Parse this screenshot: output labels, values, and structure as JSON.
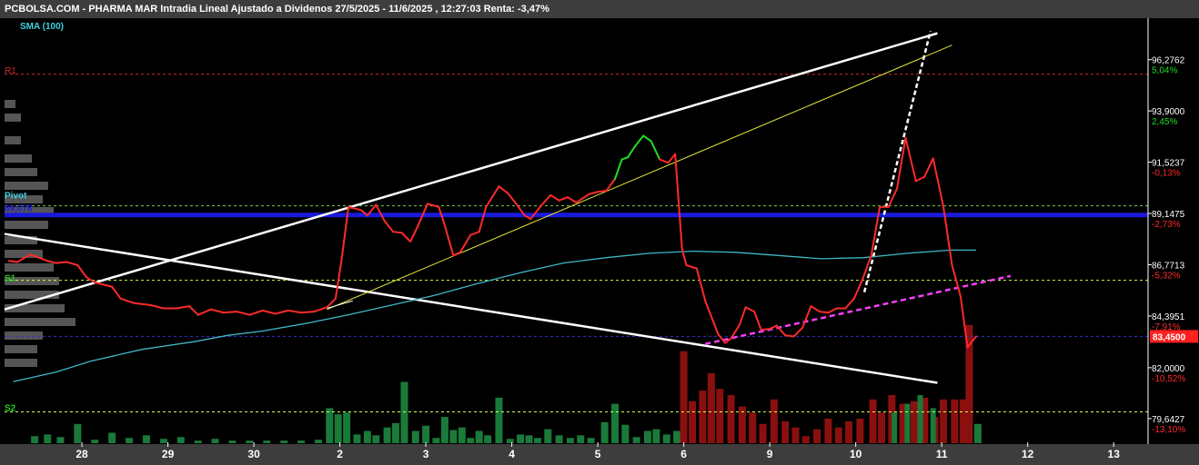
{
  "header": {
    "title": "PCBOLSA.COM - PHARMA MAR Intradia Lineal Ajustado a Dividenos 27/5/2025 - 11/6/2025 , 12:27:03 Renta: -3,47%"
  },
  "indicator_label": "SMA (100)",
  "colors": {
    "price_down": "#ff2a2a",
    "price_up": "#22dd22",
    "sma": "#3fb6c8",
    "pivot_band": "#1a1adc",
    "r1": "#d42a2a",
    "support": "#22cc22",
    "s1_line": "#c8ff50",
    "trend_white": "#ffffff",
    "trend_yellow": "#e8e838",
    "trend_magenta": "#ff40ff",
    "vol_up": "#1a7a3a",
    "vol_down": "#8a1010",
    "last_price_bg": "#ff2020"
  },
  "levels": {
    "r1": {
      "label": "R1",
      "value": 95.6
    },
    "pivot": {
      "label": "Pivot",
      "value_label": "89,078",
      "value": 89.078
    },
    "s1": {
      "label": "S1",
      "value": 86.05
    },
    "s2": {
      "label": "S2",
      "value": 79.95
    },
    "upper_dashed": 89.5,
    "current_dashed": 83.45
  },
  "last_price": "83,4500",
  "chart_data": {
    "type": "line",
    "x_tick_labels": [
      "28",
      "29",
      "30",
      "2",
      "3",
      "4",
      "5",
      "6",
      "9",
      "10",
      "11",
      "12",
      "13"
    ],
    "y_ticks": [
      {
        "value": 96.2762,
        "label": "96,2762",
        "pct": "5,04%",
        "pct_color": "#22dd22"
      },
      {
        "value": 93.9,
        "label": "93,9000",
        "pct": "2,45%",
        "pct_color": "#22dd22"
      },
      {
        "value": 91.5237,
        "label": "91,5237",
        "pct": "-0,13%",
        "pct_color": "#ff2a2a"
      },
      {
        "value": 89.1475,
        "label": "89,1475",
        "pct": "-2,73%",
        "pct_color": "#ff2a2a"
      },
      {
        "value": 86.7713,
        "label": "86,7713",
        "pct": "-5,32%",
        "pct_color": "#ff2a2a"
      },
      {
        "value": 84.3951,
        "label": "84,3951",
        "pct": "-7,91%",
        "pct_color": "#ff2a2a"
      },
      {
        "value": 82.0,
        "label": "82,0000",
        "pct": "-10,52%",
        "pct_color": "#ff2a2a"
      },
      {
        "value": 79.6427,
        "label": "79,6427",
        "pct": "-13,10%",
        "pct_color": "#ff2a2a"
      }
    ],
    "ylim": [
      78.5,
      98.2
    ],
    "x_range": [
      0,
      13.3
    ],
    "price": [
      [
        0.05,
        86.95
      ],
      [
        0.15,
        86.9
      ],
      [
        0.3,
        87.25
      ],
      [
        0.5,
        86.95
      ],
      [
        0.6,
        86.85
      ],
      [
        0.72,
        86.9
      ],
      [
        0.85,
        86.75
      ],
      [
        0.95,
        86.2
      ],
      [
        1.05,
        85.95
      ],
      [
        1.25,
        85.75
      ],
      [
        1.35,
        85.2
      ],
      [
        1.5,
        85.0
      ],
      [
        1.7,
        84.9
      ],
      [
        1.85,
        84.75
      ],
      [
        2.0,
        84.75
      ],
      [
        2.15,
        84.85
      ],
      [
        2.25,
        84.45
      ],
      [
        2.4,
        84.7
      ],
      [
        2.55,
        84.55
      ],
      [
        2.7,
        84.6
      ],
      [
        2.85,
        84.45
      ],
      [
        3.0,
        84.65
      ],
      [
        3.15,
        84.5
      ],
      [
        3.3,
        84.65
      ],
      [
        3.45,
        84.55
      ],
      [
        3.6,
        84.6
      ],
      [
        3.75,
        84.8
      ],
      [
        3.85,
        85.2
      ],
      [
        3.92,
        87.0
      ],
      [
        4.0,
        89.45
      ],
      [
        4.15,
        89.3
      ],
      [
        4.22,
        89.05
      ],
      [
        4.32,
        89.55
      ],
      [
        4.42,
        88.8
      ],
      [
        4.52,
        88.3
      ],
      [
        4.62,
        88.25
      ],
      [
        4.72,
        87.85
      ],
      [
        4.8,
        88.5
      ],
      [
        4.92,
        89.6
      ],
      [
        5.05,
        89.45
      ],
      [
        5.12,
        88.6
      ],
      [
        5.22,
        87.2
      ],
      [
        5.3,
        87.35
      ],
      [
        5.42,
        88.15
      ],
      [
        5.52,
        88.3
      ],
      [
        5.6,
        89.45
      ],
      [
        5.75,
        90.4
      ],
      [
        5.85,
        90.1
      ],
      [
        5.95,
        89.6
      ],
      [
        6.05,
        89.05
      ],
      [
        6.12,
        88.9
      ],
      [
        6.25,
        89.55
      ],
      [
        6.35,
        90.0
      ],
      [
        6.45,
        89.75
      ],
      [
        6.55,
        89.9
      ],
      [
        6.65,
        89.65
      ],
      [
        6.8,
        90.05
      ],
      [
        6.9,
        90.15
      ],
      [
        7.0,
        90.2
      ],
      [
        7.1,
        90.75
      ],
      [
        7.18,
        91.65
      ],
      [
        7.25,
        91.75
      ],
      [
        7.33,
        92.25
      ],
      [
        7.43,
        92.75
      ],
      [
        7.52,
        92.5
      ],
      [
        7.62,
        91.65
      ],
      [
        7.72,
        91.5
      ],
      [
        7.8,
        91.9
      ],
      [
        7.88,
        87.5
      ],
      [
        7.93,
        86.75
      ],
      [
        8.05,
        86.6
      ],
      [
        8.15,
        85.1
      ],
      [
        8.3,
        83.55
      ],
      [
        8.38,
        83.15
      ],
      [
        8.45,
        83.35
      ],
      [
        8.55,
        84.0
      ],
      [
        8.62,
        84.8
      ],
      [
        8.72,
        84.6
      ],
      [
        8.8,
        83.75
      ],
      [
        8.9,
        83.8
      ],
      [
        8.98,
        83.95
      ],
      [
        9.08,
        83.5
      ],
      [
        9.18,
        83.45
      ],
      [
        9.28,
        83.85
      ],
      [
        9.38,
        84.85
      ],
      [
        9.48,
        84.6
      ],
      [
        9.58,
        84.55
      ],
      [
        9.68,
        84.75
      ],
      [
        9.78,
        84.75
      ],
      [
        9.88,
        85.2
      ],
      [
        9.98,
        86.1
      ],
      [
        10.08,
        87.2
      ],
      [
        10.18,
        89.45
      ],
      [
        10.28,
        89.45
      ],
      [
        10.38,
        90.3
      ],
      [
        10.48,
        92.65
      ],
      [
        10.6,
        90.65
      ],
      [
        10.7,
        90.85
      ],
      [
        10.8,
        91.7
      ],
      [
        10.92,
        89.45
      ],
      [
        11.02,
        86.75
      ],
      [
        11.12,
        85.3
      ],
      [
        11.2,
        82.95
      ],
      [
        11.3,
        83.45
      ]
    ],
    "sma_100": [
      [
        0.1,
        81.35
      ],
      [
        0.6,
        81.8
      ],
      [
        1.0,
        82.3
      ],
      [
        1.6,
        82.85
      ],
      [
        2.2,
        83.2
      ],
      [
        2.6,
        83.5
      ],
      [
        3.0,
        83.7
      ],
      [
        3.5,
        84.05
      ],
      [
        4.0,
        84.45
      ],
      [
        4.5,
        84.9
      ],
      [
        5.0,
        85.35
      ],
      [
        5.5,
        85.9
      ],
      [
        6.0,
        86.4
      ],
      [
        6.5,
        86.85
      ],
      [
        7.0,
        87.1
      ],
      [
        7.5,
        87.3
      ],
      [
        8.0,
        87.4
      ],
      [
        8.5,
        87.35
      ],
      [
        9.0,
        87.2
      ],
      [
        9.5,
        87.05
      ],
      [
        10.0,
        87.1
      ],
      [
        10.5,
        87.3
      ],
      [
        11.0,
        87.45
      ],
      [
        11.3,
        87.45
      ]
    ],
    "volume": [
      [
        0.35,
        8
      ],
      [
        0.5,
        10
      ],
      [
        0.65,
        7
      ],
      [
        0.85,
        22
      ],
      [
        1.05,
        4
      ],
      [
        1.25,
        12
      ],
      [
        1.45,
        6
      ],
      [
        1.65,
        9
      ],
      [
        1.85,
        5
      ],
      [
        2.05,
        7
      ],
      [
        2.25,
        3
      ],
      [
        2.45,
        5
      ],
      [
        2.65,
        3
      ],
      [
        2.85,
        3
      ],
      [
        3.05,
        3
      ],
      [
        3.25,
        3
      ],
      [
        3.45,
        3
      ],
      [
        3.65,
        4
      ],
      [
        3.78,
        40
      ],
      [
        3.88,
        33
      ],
      [
        3.98,
        35
      ],
      [
        4.1,
        10
      ],
      [
        4.22,
        14
      ],
      [
        4.32,
        9
      ],
      [
        4.45,
        18
      ],
      [
        4.55,
        23
      ],
      [
        4.65,
        70
      ],
      [
        4.78,
        14
      ],
      [
        4.9,
        20
      ],
      [
        5.02,
        6
      ],
      [
        5.12,
        30
      ],
      [
        5.22,
        15
      ],
      [
        5.32,
        18
      ],
      [
        5.42,
        6
      ],
      [
        5.52,
        14
      ],
      [
        5.62,
        9
      ],
      [
        5.75,
        52
      ],
      [
        5.88,
        5
      ],
      [
        6.0,
        10
      ],
      [
        6.1,
        9
      ],
      [
        6.2,
        6
      ],
      [
        6.32,
        16
      ],
      [
        6.45,
        9
      ],
      [
        6.58,
        6
      ],
      [
        6.7,
        9
      ],
      [
        6.82,
        6
      ],
      [
        6.98,
        24
      ],
      [
        7.1,
        45
      ],
      [
        7.22,
        21
      ],
      [
        7.35,
        7
      ],
      [
        7.48,
        14
      ],
      [
        7.58,
        16
      ],
      [
        7.7,
        10
      ],
      [
        7.82,
        14
      ]
    ],
    "volume_down_marks": [
      [
        7.9,
        105
      ],
      [
        8.0,
        48
      ],
      [
        8.12,
        60
      ],
      [
        8.22,
        80
      ],
      [
        8.32,
        62
      ],
      [
        8.45,
        55
      ],
      [
        8.58,
        42
      ],
      [
        8.7,
        35
      ],
      [
        8.82,
        22
      ],
      [
        8.95,
        50
      ],
      [
        9.08,
        25
      ],
      [
        9.2,
        18
      ],
      [
        9.32,
        8
      ],
      [
        9.45,
        16
      ],
      [
        9.58,
        28
      ],
      [
        9.7,
        18
      ],
      [
        9.82,
        25
      ],
      [
        9.95,
        28
      ],
      [
        10.1,
        50
      ],
      [
        10.2,
        35
      ],
      [
        10.32,
        55
      ],
      [
        10.45,
        45
      ],
      [
        10.58,
        48
      ],
      [
        10.7,
        52
      ],
      [
        10.82,
        30
      ],
      [
        10.92,
        50
      ]
    ],
    "volume_up_marks": [
      [
        10.35,
        35
      ],
      [
        10.5,
        45
      ],
      [
        10.65,
        55
      ],
      [
        10.8,
        40
      ]
    ],
    "volume_last": [
      [
        11.05,
        50
      ],
      [
        11.15,
        50
      ],
      [
        11.22,
        135
      ],
      [
        11.32,
        22
      ]
    ],
    "volume_range": [
      0,
      140
    ],
    "legend": "none",
    "grid": false
  }
}
